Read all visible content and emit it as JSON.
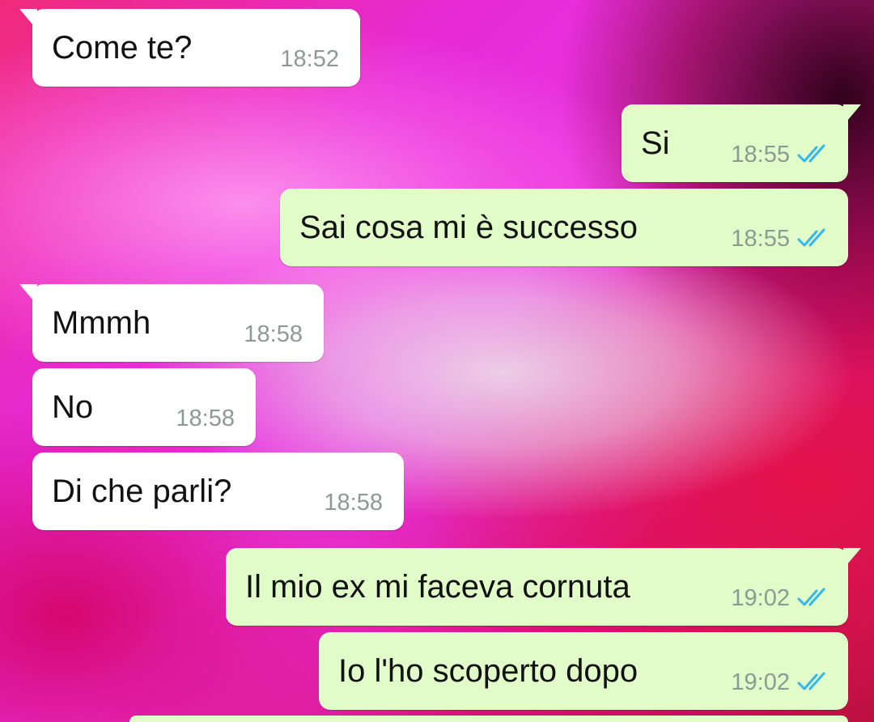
{
  "messages": [
    {
      "text": "Come te?",
      "time": "18:52",
      "direction": "incoming",
      "status": ""
    },
    {
      "text": "Si",
      "time": "18:55",
      "direction": "outgoing",
      "status": "read-double-check"
    },
    {
      "text": "Sai cosa mi è successo",
      "time": "18:55",
      "direction": "outgoing",
      "status": "read-double-check"
    },
    {
      "text": "Mmmh",
      "time": "18:58",
      "direction": "incoming",
      "status": ""
    },
    {
      "text": "No",
      "time": "18:58",
      "direction": "incoming",
      "status": ""
    },
    {
      "text": "Di che parli?",
      "time": "18:58",
      "direction": "incoming",
      "status": ""
    },
    {
      "text": "Il mio ex mi faceva cornuta",
      "time": "19:02",
      "direction": "outgoing",
      "status": "read-double-check"
    },
    {
      "text": "Io l'ho scoperto dopo",
      "time": "19:02",
      "direction": "outgoing",
      "status": "read-double-check"
    }
  ],
  "colors": {
    "incoming_bubble": "#ffffff",
    "outgoing_bubble": "#e1fcc9",
    "read_check": "#34b7f1",
    "timestamp": "#8c9a94",
    "wallpaper_primary": "#e62ad8",
    "wallpaper_secondary": "#d8107a"
  },
  "icons": {
    "read_receipt": "double-check-icon"
  }
}
